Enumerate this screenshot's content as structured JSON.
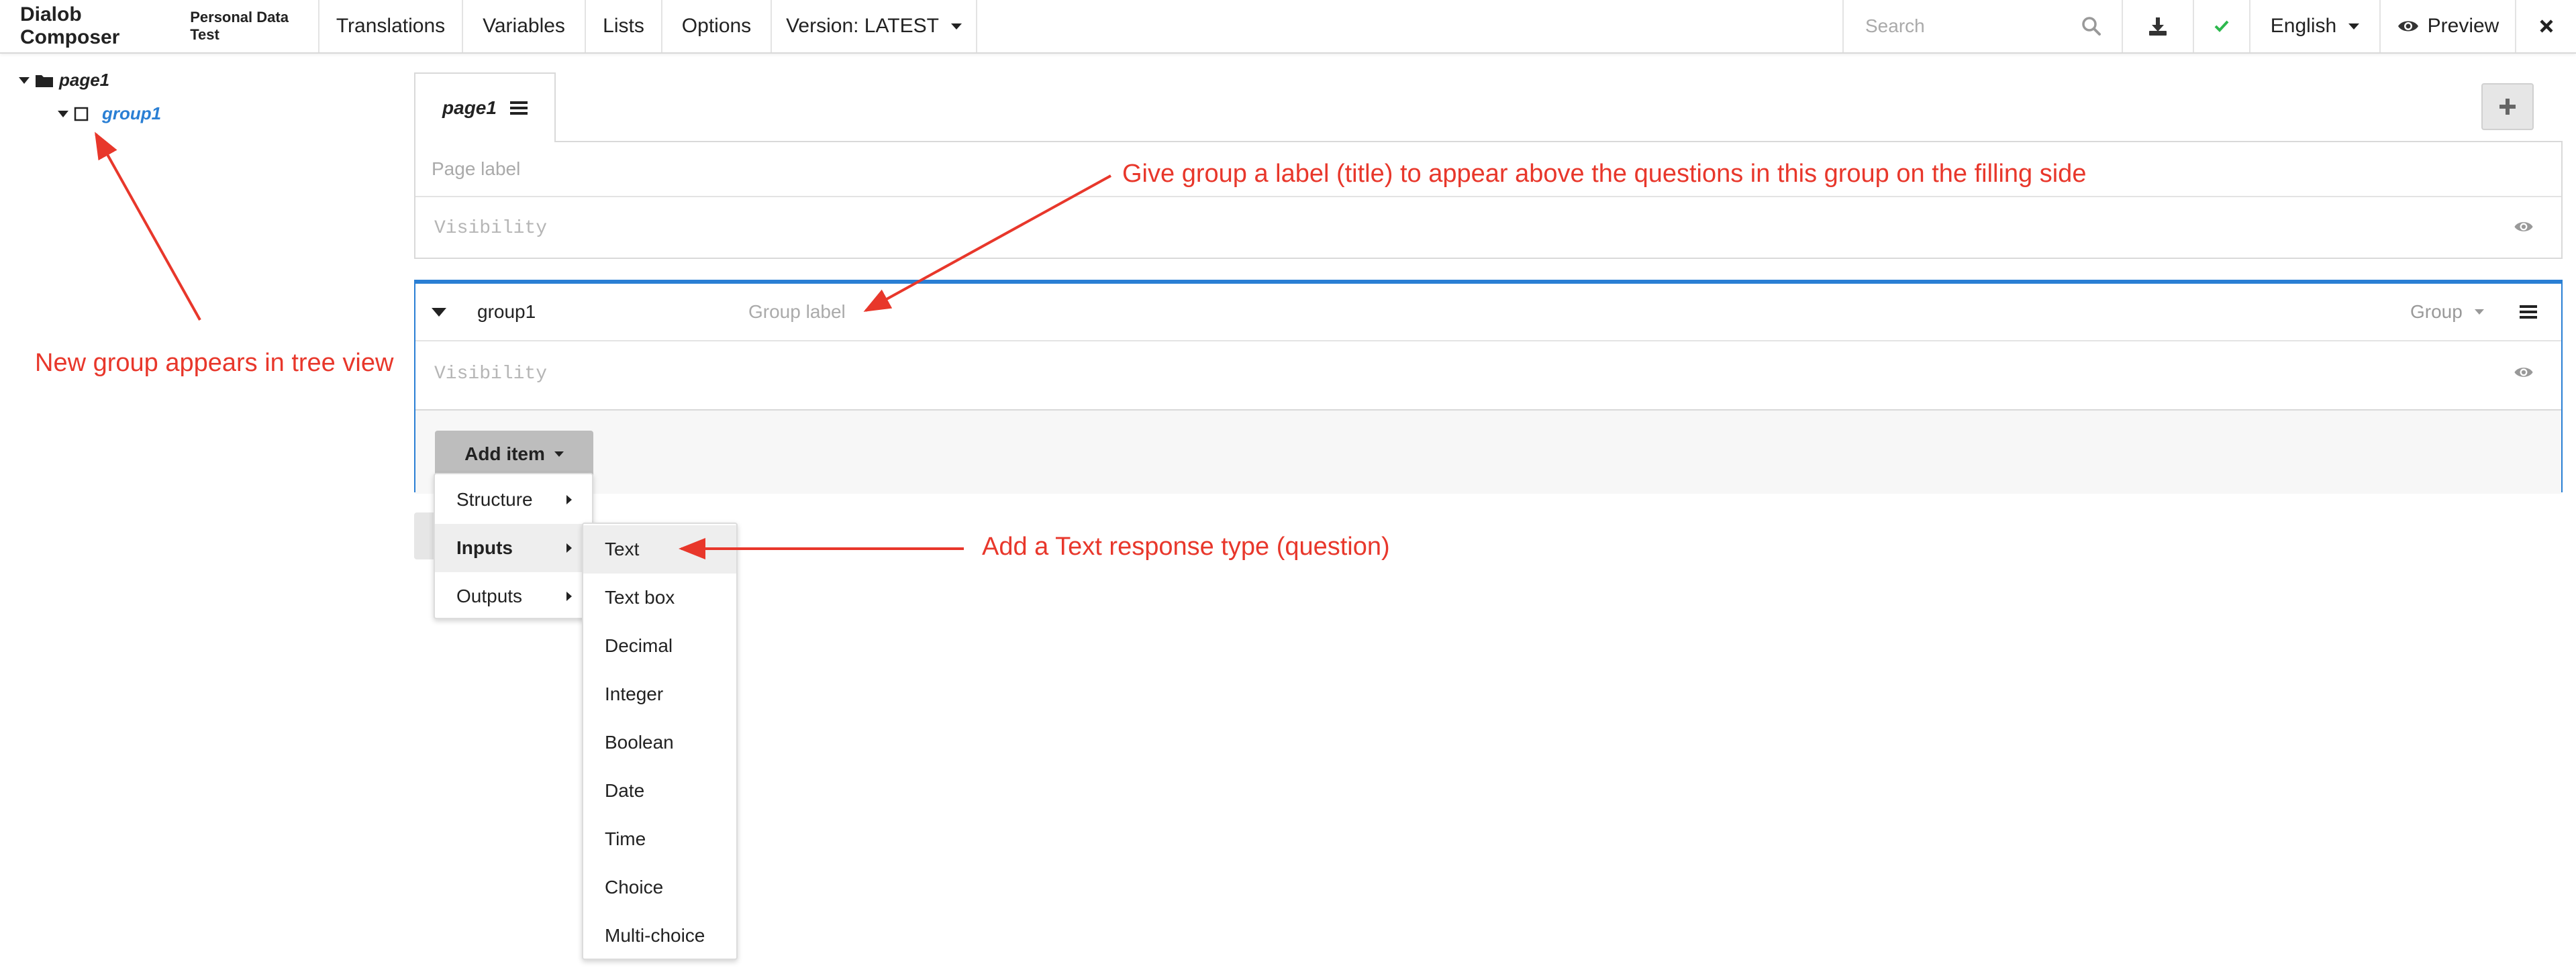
{
  "header": {
    "app_name": "Dialob Composer",
    "document_name": "Personal Data Test",
    "nav": [
      "Translations",
      "Variables",
      "Lists",
      "Options"
    ],
    "version_label": "Version: LATEST",
    "search_placeholder": "Search",
    "language": "English",
    "preview_label": "Preview"
  },
  "tree": {
    "page": "page1",
    "group": "group1"
  },
  "page_tab": {
    "label": "page1"
  },
  "page_panel": {
    "label_placeholder": "Page label",
    "visibility_placeholder": "Visibility"
  },
  "group_panel": {
    "id": "group1",
    "label_placeholder": "Group label",
    "type": "Group",
    "visibility_placeholder": "Visibility",
    "add_item_label": "Add item"
  },
  "add_item_menu": [
    "Structure",
    "Inputs",
    "Outputs"
  ],
  "inputs_submenu": [
    "Text",
    "Text box",
    "Decimal",
    "Integer",
    "Boolean",
    "Date",
    "Time",
    "Choice",
    "Multi-choice"
  ],
  "annotations": {
    "tree_note": "New group appears in tree view",
    "label_note": "Give group a label (title) to appear above the questions in this group on the filling side",
    "text_note": "Add a Text response type (question)"
  },
  "colors": {
    "accent_blue": "#2a7fd4",
    "annotation_red": "#e8372b",
    "check_green": "#2db84d",
    "tree_group_blue": "#2a7fd4"
  },
  "icons": [
    "search-icon",
    "download-icon",
    "check-icon",
    "eye-icon",
    "close-icon",
    "hamburger-icon",
    "plus-icon",
    "folder-icon",
    "checkbox-icon"
  ]
}
